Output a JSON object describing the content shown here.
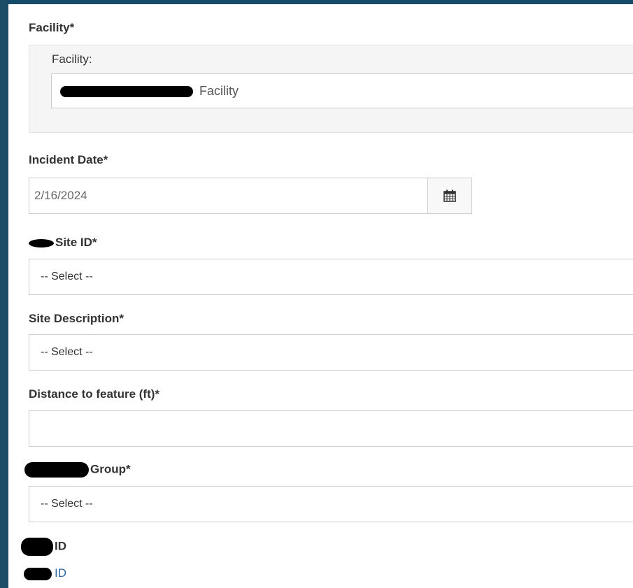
{
  "form": {
    "facility": {
      "label": "Facility*",
      "inner_label": "Facility:",
      "value_suffix": "Facility"
    },
    "incident_date": {
      "label": "Incident Date*",
      "value": "2/16/2024",
      "calendar_icon": "calendar-icon"
    },
    "site_id": {
      "label": "Site ID*",
      "value": "-- Select --"
    },
    "site_description": {
      "label": "Site Description*",
      "value": "-- Select --"
    },
    "distance": {
      "label": "Distance to feature (ft)*",
      "value": ""
    },
    "group": {
      "label": "Group*",
      "value": "-- Select --"
    },
    "id_label": "ID",
    "id_link": "ID"
  },
  "colors": {
    "frame": "#1d4f6a",
    "link": "#2a6aa8",
    "well_bg": "#f5f5f5"
  }
}
